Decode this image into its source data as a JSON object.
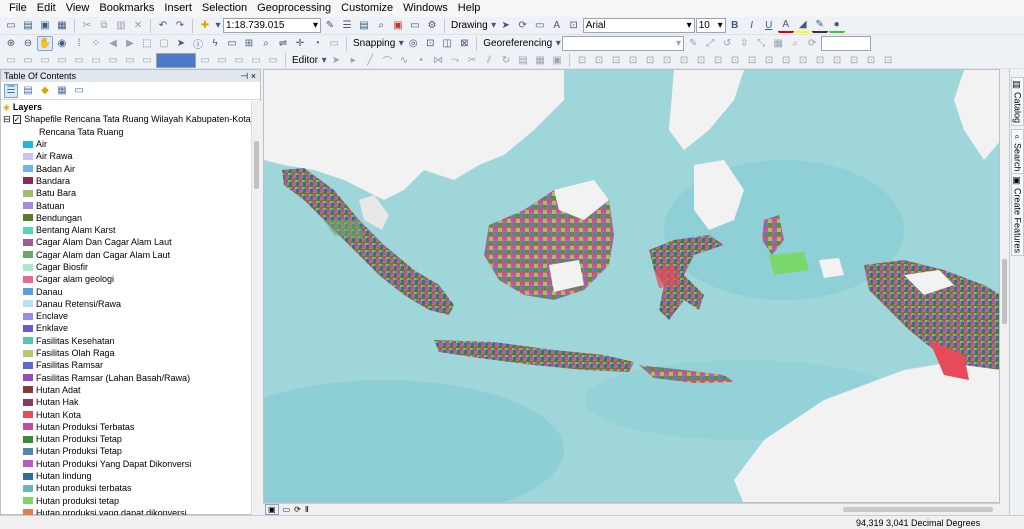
{
  "menubar": [
    "File",
    "Edit",
    "View",
    "Bookmarks",
    "Insert",
    "Selection",
    "Geoprocessing",
    "Customize",
    "Windows",
    "Help"
  ],
  "toolbar": {
    "scale": "1:18.739.015",
    "drawing_label": "Drawing",
    "font_name": "Arial",
    "font_size": "10",
    "bold": "B",
    "italic": "I",
    "underline": "U",
    "font_color": "A",
    "snapping_label": "Snapping",
    "georeferencing_label": "Georeferencing",
    "editor_label": "Editor"
  },
  "toc": {
    "title": "Table Of Contents",
    "pin": "⊣ ×",
    "layers_label": "Layers",
    "layer_name": "Shapefile Rencana Tata Ruang Wilayah Kabupaten-Kota_ATR-B",
    "field_name": "Rencana Tata Ruang",
    "legend": [
      {
        "label": "Air",
        "color": "#1fb5e0"
      },
      {
        "label": "Air Rawa",
        "color": "#c6c6f0"
      },
      {
        "label": "Badan Air",
        "color": "#6fb4e8"
      },
      {
        "label": "Bandara",
        "color": "#8c2b4e"
      },
      {
        "label": "Batu Bara",
        "color": "#9fbf6a"
      },
      {
        "label": "Batuan",
        "color": "#a88ae0"
      },
      {
        "label": "Bendungan",
        "color": "#5a7a2a"
      },
      {
        "label": "Bentang Alam Karst",
        "color": "#55d6b5"
      },
      {
        "label": "Cagar Alam Dan Cagar Alam Laut",
        "color": "#a45a8c"
      },
      {
        "label": "Cagar Alam dan Cagar Alam Laut",
        "color": "#6aa86a"
      },
      {
        "label": "Cagar Biosfir",
        "color": "#a8e8c8"
      },
      {
        "label": "Cagar alam geologi",
        "color": "#e86a8a"
      },
      {
        "label": "Danau",
        "color": "#5aa0e0"
      },
      {
        "label": "Danau Retensi/Rawa",
        "color": "#b8e0f0"
      },
      {
        "label": "Enclave",
        "color": "#9a8ae8"
      },
      {
        "label": "Enklave",
        "color": "#6a5ad0"
      },
      {
        "label": "Fasilitas Kesehatan",
        "color": "#5ac8a8"
      },
      {
        "label": "Fasilitas Olah Raga",
        "color": "#b8c86a"
      },
      {
        "label": "Fasilitas Ramsar",
        "color": "#5a6ad0"
      },
      {
        "label": "Fasilitas Ramsar (Lahan Basah/Rawa)",
        "color": "#9a4ab8"
      },
      {
        "label": "Hutan Adat",
        "color": "#8a3a3a"
      },
      {
        "label": "Hutan Hak",
        "color": "#8a3a5a"
      },
      {
        "label": "Hutan Kota",
        "color": "#e84a5a"
      },
      {
        "label": "Hutan Produksi Terbatas",
        "color": "#c84aa8"
      },
      {
        "label": "Hutan Produksi Tetap",
        "color": "#3a8a3a"
      },
      {
        "label": "Hutan Produksi Tetap",
        "color": "#4a8aa8"
      },
      {
        "label": "Hutan Produksi Yang Dapat Dikonversi",
        "color": "#b85ac8"
      },
      {
        "label": "Hutan lindung",
        "color": "#3a6a9a"
      },
      {
        "label": "Hutan produksi terbatas",
        "color": "#6ab8b8"
      },
      {
        "label": "Hutan produksi tetap",
        "color": "#7ad86a"
      },
      {
        "label": "Hutan produksi yang dapat dikonversi",
        "color": "#e87a4a"
      }
    ]
  },
  "map": {
    "sea_color": "#9fd6d9",
    "land_color": "#f2f2f2"
  },
  "status": {
    "coordinates": "94,319  3,041 Decimal Degrees"
  },
  "right_dock": {
    "catalog": "Catalog",
    "search": "Search",
    "create_features": "Create Features"
  }
}
